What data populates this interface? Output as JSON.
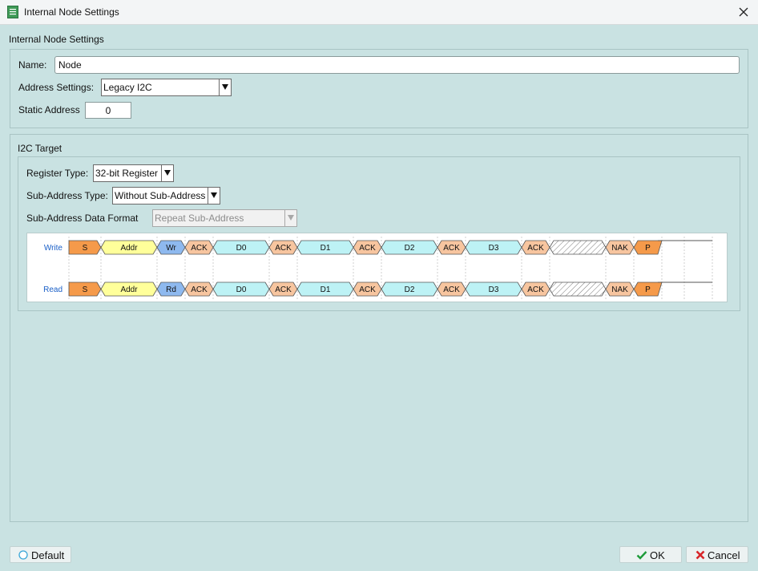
{
  "window": {
    "title": "Internal Node Settings"
  },
  "node_settings": {
    "section_title": "Internal Node Settings",
    "name_label": "Name:",
    "name_value": "Node",
    "address_label": "Address Settings:",
    "address_value": "Legacy I2C",
    "static_label": "Static Address",
    "static_value": "0"
  },
  "target": {
    "section_title": "I2C Target",
    "register_type_label": "Register Type:",
    "register_type_value": "32-bit Register",
    "sub_address_type_label": "Sub-Address Type:",
    "sub_address_type_value": "Without Sub-Address",
    "sub_address_format_label": "Sub-Address Data Format",
    "sub_address_format_value": "Repeat Sub-Address"
  },
  "timing": {
    "rows": [
      {
        "label": "Write",
        "segments": [
          {
            "text": "S",
            "kind": "start"
          },
          {
            "text": "Addr",
            "kind": "addr"
          },
          {
            "text": "Wr",
            "kind": "rw"
          },
          {
            "text": "ACK",
            "kind": "ack"
          },
          {
            "text": "D0",
            "kind": "data"
          },
          {
            "text": "ACK",
            "kind": "ack"
          },
          {
            "text": "D1",
            "kind": "data"
          },
          {
            "text": "ACK",
            "kind": "ack"
          },
          {
            "text": "D2",
            "kind": "data"
          },
          {
            "text": "ACK",
            "kind": "ack"
          },
          {
            "text": "D3",
            "kind": "data"
          },
          {
            "text": "ACK",
            "kind": "ack"
          },
          {
            "text": "",
            "kind": "hatch"
          },
          {
            "text": "NAK",
            "kind": "ack"
          },
          {
            "text": "P",
            "kind": "stop"
          }
        ]
      },
      {
        "label": "Read",
        "segments": [
          {
            "text": "S",
            "kind": "start"
          },
          {
            "text": "Addr",
            "kind": "addr"
          },
          {
            "text": "Rd",
            "kind": "rw"
          },
          {
            "text": "ACK",
            "kind": "ack"
          },
          {
            "text": "D0",
            "kind": "data"
          },
          {
            "text": "ACK",
            "kind": "ack"
          },
          {
            "text": "D1",
            "kind": "data"
          },
          {
            "text": "ACK",
            "kind": "ack"
          },
          {
            "text": "D2",
            "kind": "data"
          },
          {
            "text": "ACK",
            "kind": "ack"
          },
          {
            "text": "D3",
            "kind": "data"
          },
          {
            "text": "ACK",
            "kind": "ack"
          },
          {
            "text": "",
            "kind": "hatch"
          },
          {
            "text": "NAK",
            "kind": "ack"
          },
          {
            "text": "P",
            "kind": "stop"
          }
        ]
      }
    ],
    "colors": {
      "start": "#f59a4a",
      "addr": "#ffff9a",
      "rw": "#8eb9ef",
      "ack": "#f7c59f",
      "data": "#bdf2f5",
      "stop": "#f59a4a",
      "label": "#1a5fc7"
    }
  },
  "footer": {
    "default_label": "Default",
    "ok_label": "OK",
    "cancel_label": "Cancel"
  }
}
